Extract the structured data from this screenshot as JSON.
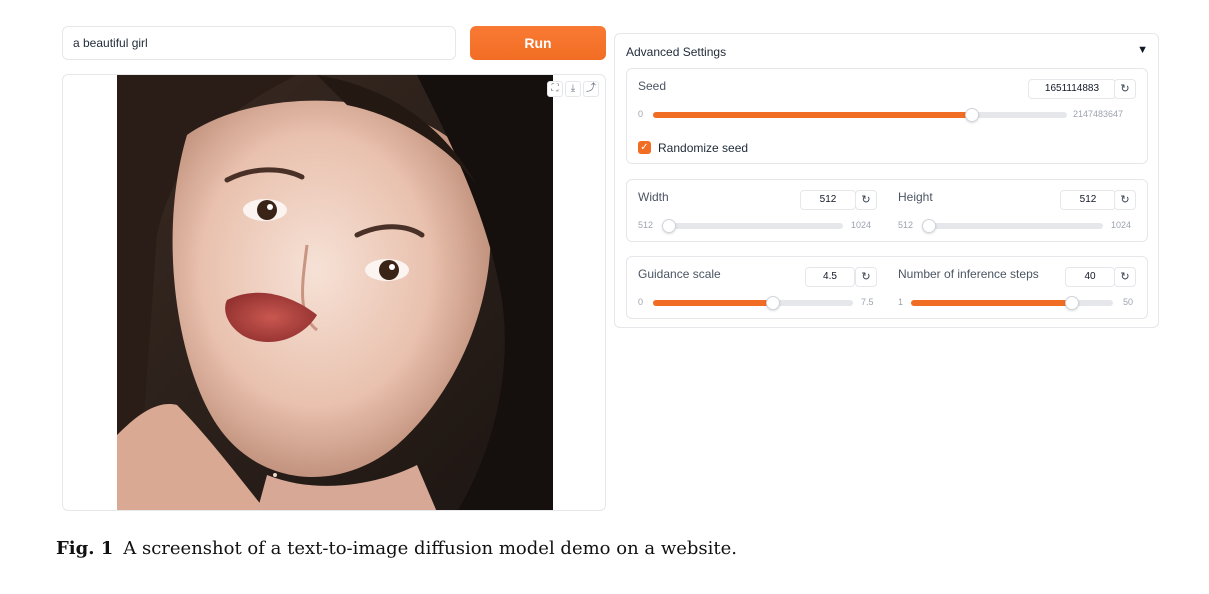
{
  "prompt": {
    "value": "a beautiful girl"
  },
  "run_button": {
    "label": "Run"
  },
  "image_toolbar": {
    "icons": [
      "fullscreen-icon",
      "download-icon",
      "share-icon"
    ],
    "glyphs": [
      "⛶",
      "⤓",
      "⤴"
    ]
  },
  "advanced": {
    "title": "Advanced Settings",
    "caret": "▼",
    "seed": {
      "label": "Seed",
      "value": "1651114883",
      "min": "0",
      "max": "2147483647",
      "fraction": 0.77
    },
    "randomize": {
      "label": "Randomize seed",
      "checked": true,
      "mark": "✓"
    },
    "width": {
      "label": "Width",
      "value": "512",
      "min": "512",
      "max": "1024",
      "fraction": 0.0
    },
    "height": {
      "label": "Height",
      "value": "512",
      "min": "512",
      "max": "1024",
      "fraction": 0.0
    },
    "guidance": {
      "label": "Guidance scale",
      "value": "4.5",
      "min": "0",
      "max": "7.5",
      "fraction": 0.6
    },
    "steps": {
      "label": "Number of inference steps",
      "value": "40",
      "min": "1",
      "max": "50",
      "fraction": 0.7959
    },
    "reset_glyph": "↻"
  },
  "colors": {
    "accent": "#f26d24",
    "track": "#e5e7eb",
    "border": "#e5e7eb"
  },
  "caption": {
    "label": "Fig. 1",
    "text": "A screenshot of a text-to-image diffusion model demo on a website."
  }
}
